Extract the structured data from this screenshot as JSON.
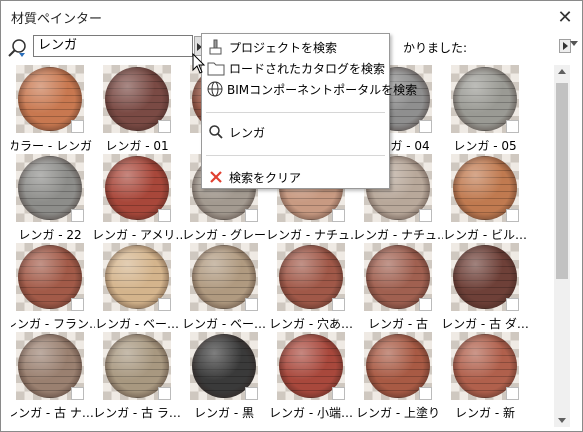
{
  "window": {
    "title": "材質ペインター",
    "close_glyph": "✕"
  },
  "search": {
    "value": "レンガ",
    "result_text": "かりました:"
  },
  "menu": {
    "items": [
      {
        "label": "プロジェクトを検索",
        "icon": "brush-icon"
      },
      {
        "label": "ロードされたカタログを検索",
        "icon": "folder-icon"
      },
      {
        "label": "BIMコンポーネントポータルを検索",
        "icon": "globe-icon"
      },
      {
        "label": "レンガ",
        "icon": "search-icon"
      },
      {
        "label": "検索をクリア",
        "icon": "clear-x-icon"
      }
    ]
  },
  "materials": [
    {
      "label": "カラー - レンガ",
      "color": "#c87850"
    },
    {
      "label": "レンガ - 01",
      "color": "#7a4a44"
    },
    {
      "label": "",
      "color": "#9a5a48"
    },
    {
      "label": "",
      "color": "#8a5040"
    },
    {
      "label": "レンガ - 04",
      "color": "#8f8f8f"
    },
    {
      "label": "レンガ - 05",
      "color": "#9a9a94"
    },
    {
      "label": "レンガ - 22",
      "color": "#8d8d8a"
    },
    {
      "label": "レンガ - アメリ…",
      "color": "#a8473a"
    },
    {
      "label": "レンガ - グレー",
      "color": "#a39a90"
    },
    {
      "label": "レンガ - ナチュ…",
      "color": "#c89a82"
    },
    {
      "label": "レンガ - ナチュ…",
      "color": "#b8a89a"
    },
    {
      "label": "レンガ - ビル…",
      "color": "#c07a50"
    },
    {
      "label": "レンガ - フラン…",
      "color": "#a25a48"
    },
    {
      "label": "レンガ - ベー…",
      "color": "#d4b48c"
    },
    {
      "label": "レンガ - ベー…",
      "color": "#b09a80"
    },
    {
      "label": "レンガ - 穴あ…",
      "color": "#a05848"
    },
    {
      "label": "レンガ - 古",
      "color": "#a06050"
    },
    {
      "label": "レンガ - 古 ダ…",
      "color": "#6e4038"
    },
    {
      "label": "レンガ - 古 ナ…",
      "color": "#9a8070"
    },
    {
      "label": "レンガ - 古 ラ…",
      "color": "#a89880"
    },
    {
      "label": "レンガ - 黒",
      "color": "#3a3a3a"
    },
    {
      "label": "レンガ - 小端…",
      "color": "#a8483c"
    },
    {
      "label": "レンガ - 上塗り",
      "color": "#a85a44"
    },
    {
      "label": "レンガ - 新",
      "color": "#b0604c"
    }
  ]
}
